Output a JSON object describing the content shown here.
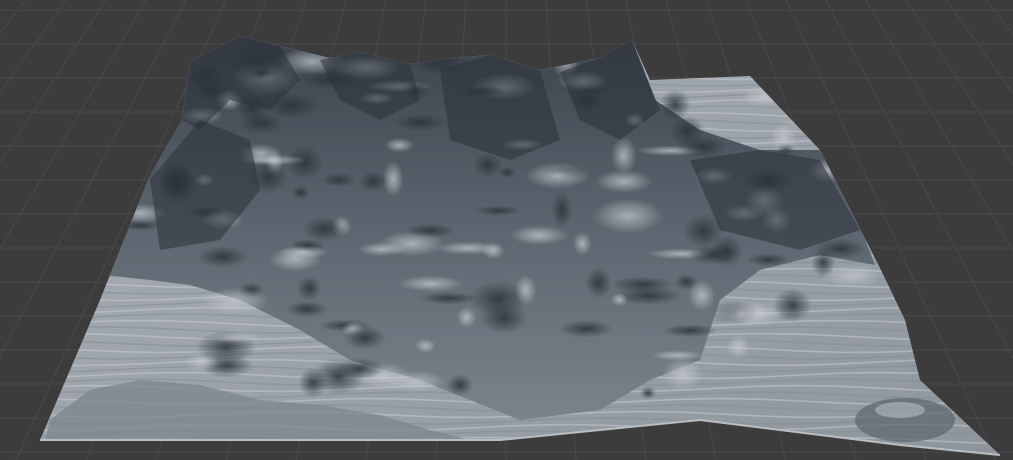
{
  "viewport": {
    "background_color": "#3c3c3c",
    "grid_color": "#4a4a4a",
    "grid_shown": true
  },
  "terrain": {
    "description_icon": "terrain-mesh",
    "base_color": "#9ea6ad",
    "rock_color": "#7b8490",
    "shadow_color": "#2b323b",
    "highlight_color": "#c9cfd4",
    "edge_color": "#b8bec3"
  }
}
